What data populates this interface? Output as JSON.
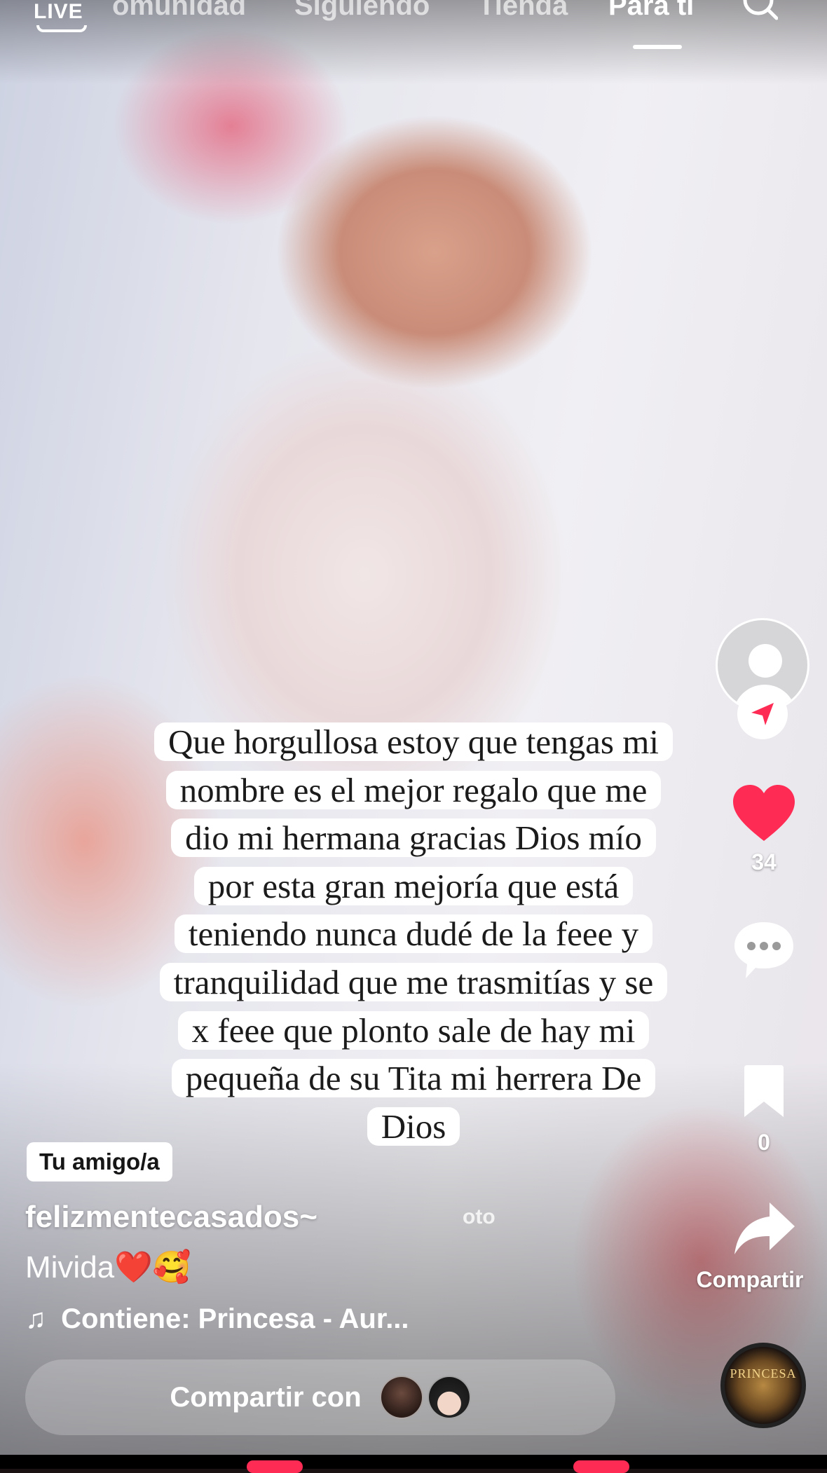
{
  "top_nav": {
    "live_label": "LIVE",
    "tabs": [
      {
        "label": "omunidad"
      },
      {
        "label": "Siguiendo"
      },
      {
        "label": "Tienda"
      },
      {
        "label": "Para ti",
        "active": true
      }
    ],
    "search_icon": "search-icon"
  },
  "caption": {
    "text": "Que horgullosa estoy que tengas mi nombre es el mejor regalo que me dio mi hermana gracias Dios mío por esta gran mejoría que está teniendo nunca dudé de la feee y tranquilidad que me trasmitías y se x feee que plonto sale de hay mi pequeña de su Tita mi herrera De Dios"
  },
  "rail": {
    "like_count": "34",
    "save_count": "0",
    "share_label": "Compartir",
    "like_color": "#fe2c55"
  },
  "video_info": {
    "friend_badge": "Tu amigo/a",
    "username": "felizmentecasados~",
    "username_suffix": "oto",
    "description": "Mivida❤️🥰",
    "music_prefix": "♫",
    "music_text": "Contiene: Princesa - Aur..."
  },
  "share_bar": {
    "label": "Compartir con"
  },
  "music_disc": {
    "text": "PRINCESA"
  }
}
